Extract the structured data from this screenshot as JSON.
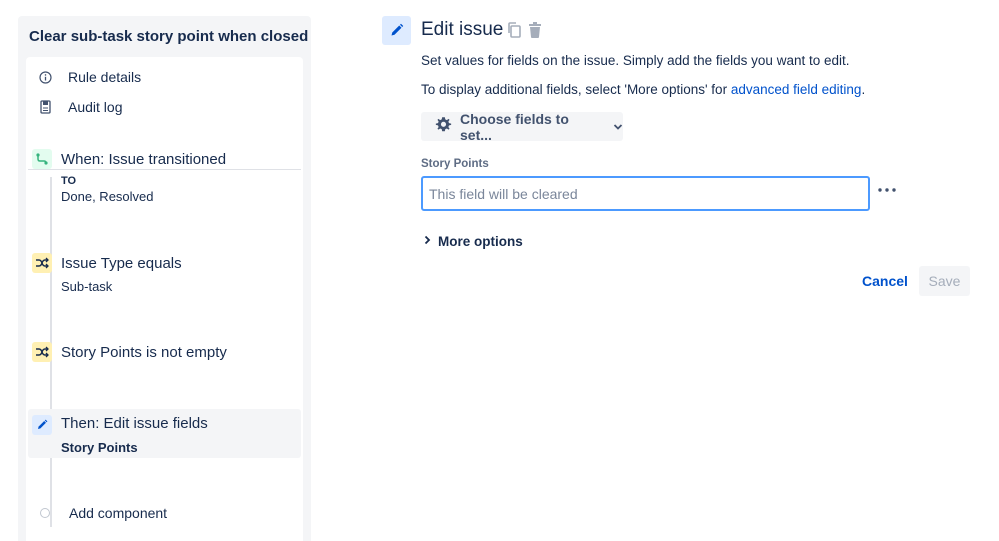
{
  "sidebar": {
    "title": "Clear sub-task story point when closed",
    "nav": [
      {
        "label": "Rule details",
        "icon": "info-icon"
      },
      {
        "label": "Audit log",
        "icon": "document-icon"
      }
    ],
    "steps": [
      {
        "title": "When: Issue transitioned",
        "to_label": "TO",
        "sub": "Done, Resolved",
        "icon": "transition-icon",
        "color": "#e3fcef"
      },
      {
        "title": "Issue Type equals",
        "sub": "Sub-task",
        "icon": "shuffle-icon",
        "color": "#fff0b3"
      },
      {
        "title": "Story Points is not empty",
        "icon": "shuffle-icon",
        "color": "#fff0b3"
      },
      {
        "title": "Then: Edit issue fields",
        "sub": "Story Points",
        "icon": "pencil-icon",
        "color": "#deebff"
      }
    ],
    "add_component": "Add component"
  },
  "main": {
    "title": "Edit issue",
    "desc1": "Set values for fields on the issue. Simply add the fields you want to edit.",
    "desc2_prefix": "To display additional fields, select 'More options' for ",
    "desc2_link": "advanced field editing",
    "desc2_suffix": ".",
    "choose_fields": "Choose fields to set...",
    "field_label": "Story Points",
    "field_placeholder": "This field will be cleared",
    "more_options": "More options",
    "cancel": "Cancel",
    "save": "Save"
  },
  "colors": {
    "accent": "#0052cc",
    "focus": "#4c9aff"
  }
}
